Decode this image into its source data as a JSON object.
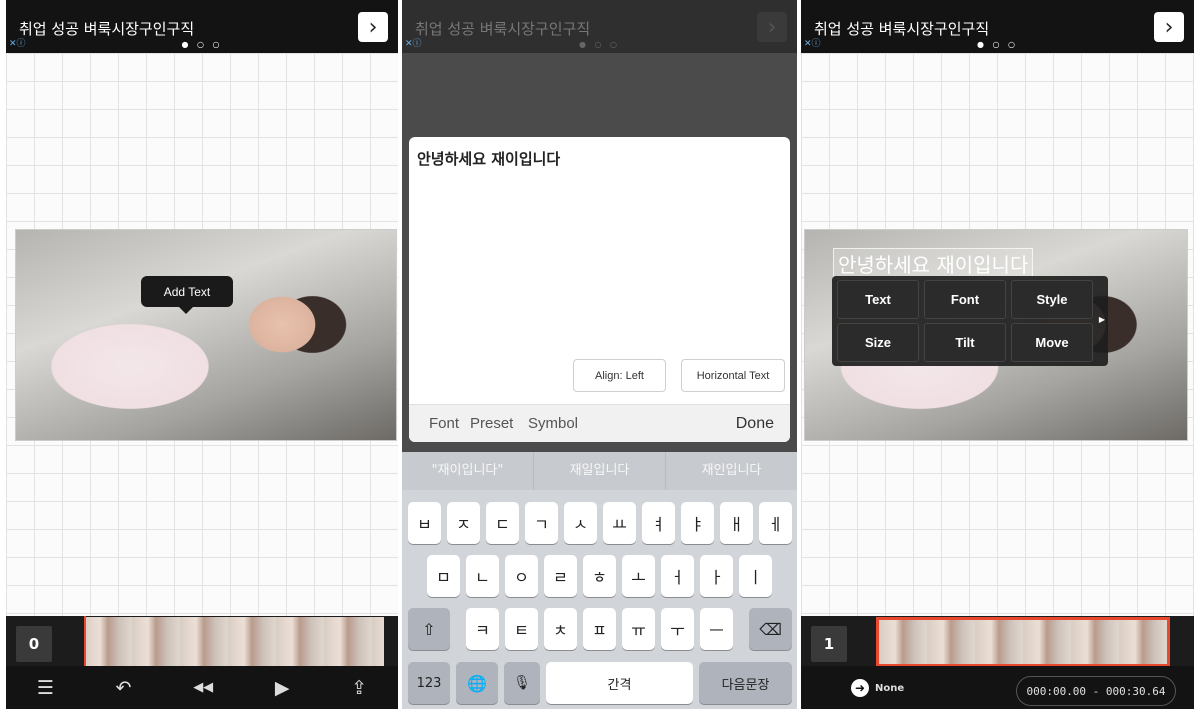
{
  "ad": {
    "title": "취업 성공 벼룩시장구인구직",
    "dots": "● ○ ○",
    "arrow": "›",
    "close": "✕ⓘ"
  },
  "panel1": {
    "tooltip": "Add Text",
    "clip_number": "0",
    "bottom_bar": {
      "menu_icon": "☰",
      "undo_icon": "↶",
      "rewind_icon": "◀◀",
      "play_icon": "▶",
      "share_icon": "⇪"
    }
  },
  "panel2": {
    "editor_text": "안녕하세요 재이입니다",
    "align_button": "Align: Left",
    "horizontal_button": "Horizontal Text",
    "toolbar": {
      "font": "Font",
      "preset": "Preset",
      "symbol": "Symbol",
      "done": "Done"
    },
    "suggestions": [
      "\"재이입니다\"",
      "재일입니다",
      "재인입니다"
    ],
    "keys_row1": [
      "ㅂ",
      "ㅈ",
      "ㄷ",
      "ㄱ",
      "ㅅ",
      "ㅛ",
      "ㅕ",
      "ㅑ",
      "ㅐ",
      "ㅔ"
    ],
    "keys_row2": [
      "ㅁ",
      "ㄴ",
      "ㅇ",
      "ㄹ",
      "ㅎ",
      "ㅗ",
      "ㅓ",
      "ㅏ",
      "ㅣ"
    ],
    "keys_row3": [
      "ㅋ",
      "ㅌ",
      "ㅊ",
      "ㅍ",
      "ㅠ",
      "ㅜ",
      "ㅡ"
    ],
    "shift": "⇧",
    "delete": "⌫",
    "num_key": "123",
    "globe": "🌐",
    "mic": "🎙",
    "space": "간격",
    "return": "다음문장"
  },
  "panel3": {
    "overlay_text": "안녕하세요 재이입니다",
    "menu": [
      "Text",
      "Font",
      "Style",
      "Size",
      "Tilt",
      "Move"
    ],
    "clip_number": "1",
    "transition": "None",
    "timecode": "000:00.00 - 000:30.64"
  }
}
